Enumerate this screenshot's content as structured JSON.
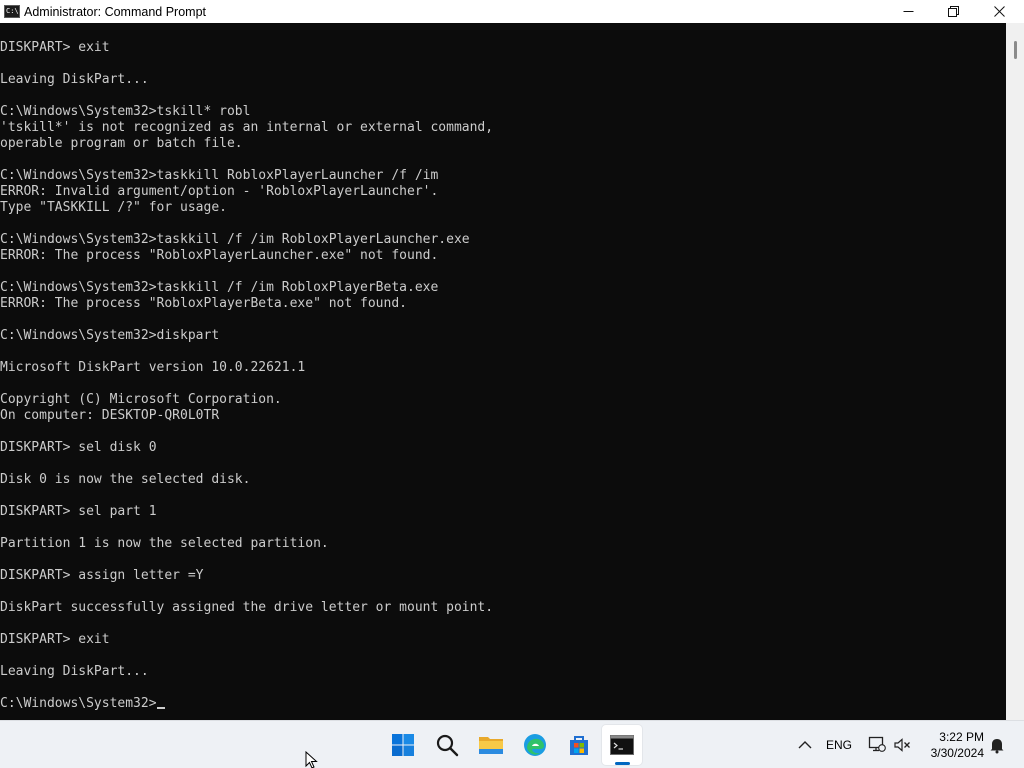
{
  "window": {
    "title": "Administrator: Command Prompt",
    "icon_label": "C:\\",
    "controls": [
      "minimize-icon",
      "maximize-icon",
      "close-icon"
    ]
  },
  "console": {
    "lines": [
      "DISKPART> exit",
      "",
      "Leaving DiskPart...",
      "",
      "C:\\Windows\\System32>tskill* robl",
      "'tskill*' is not recognized as an internal or external command,",
      "operable program or batch file.",
      "",
      "C:\\Windows\\System32>taskkill RobloxPlayerLauncher /f /im",
      "ERROR: Invalid argument/option - 'RobloxPlayerLauncher'.",
      "Type \"TASKKILL /?\" for usage.",
      "",
      "C:\\Windows\\System32>taskkill /f /im RobloxPlayerLauncher.exe",
      "ERROR: The process \"RobloxPlayerLauncher.exe\" not found.",
      "",
      "C:\\Windows\\System32>taskkill /f /im RobloxPlayerBeta.exe",
      "ERROR: The process \"RobloxPlayerBeta.exe\" not found.",
      "",
      "C:\\Windows\\System32>diskpart",
      "",
      "Microsoft DiskPart version 10.0.22621.1",
      "",
      "Copyright (C) Microsoft Corporation.",
      "On computer: DESKTOP-QR0L0TR",
      "",
      "DISKPART> sel disk 0",
      "",
      "Disk 0 is now the selected disk.",
      "",
      "DISKPART> sel part 1",
      "",
      "Partition 1 is now the selected partition.",
      "",
      "DISKPART> assign letter =Y",
      "",
      "DiskPart successfully assigned the drive letter or mount point.",
      "",
      "DISKPART> exit",
      "",
      "Leaving DiskPart...",
      ""
    ],
    "prompt": "C:\\Windows\\System32>",
    "text_color": "#cccccc",
    "background": "#0c0c0c"
  },
  "taskbar": {
    "apps": [
      {
        "name": "start",
        "icon": "windows-logo-icon"
      },
      {
        "name": "search",
        "icon": "search-icon"
      },
      {
        "name": "file-explorer",
        "icon": "folder-icon"
      },
      {
        "name": "edge",
        "icon": "edge-icon"
      },
      {
        "name": "microsoft-store",
        "icon": "store-icon"
      },
      {
        "name": "command-prompt",
        "icon": "terminal-icon",
        "active": true
      }
    ],
    "tray": {
      "language": "ENG",
      "time": "3:22 PM",
      "date": "3/30/2024"
    },
    "accent": "#0067c0"
  }
}
